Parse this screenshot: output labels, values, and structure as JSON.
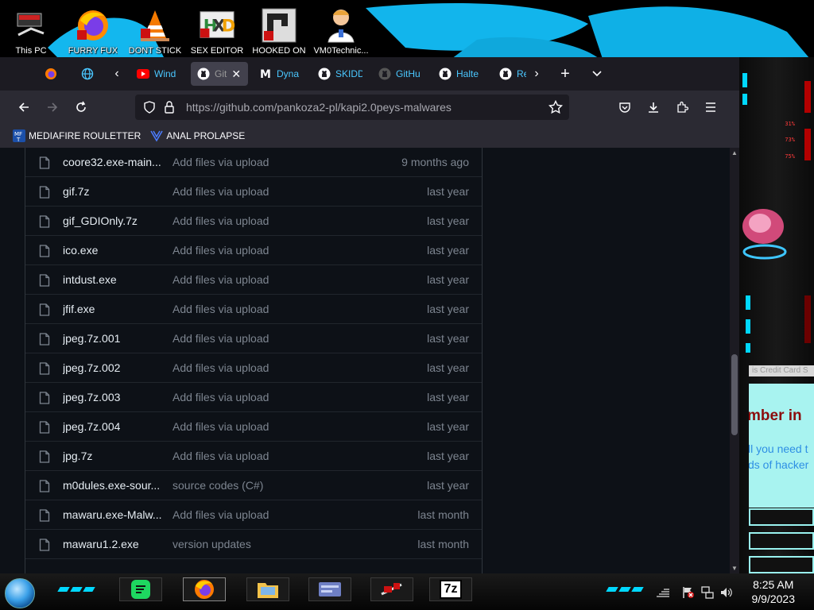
{
  "desktop": {
    "icons": [
      {
        "label": "This PC",
        "icon": "this-pc-icon"
      },
      {
        "label": "FURRY FUX",
        "icon": "firefox-icon"
      },
      {
        "label": "DONT STICK",
        "icon": "vlc-icon"
      },
      {
        "label": "SEX EDITOR",
        "icon": "hxd-icon"
      },
      {
        "label": "HOOKED ON",
        "icon": "hooked-on-icon"
      },
      {
        "label": "VM0Technic...",
        "icon": "doctor-icon"
      }
    ]
  },
  "side_panel": {
    "stats": [
      "31%",
      "73%",
      "75%"
    ],
    "cc_bar": "is Credit Card S",
    "cyan_big": "mber in",
    "cyan_line1": "ll you need t",
    "cyan_line2": "ds of hacker"
  },
  "tabs": [
    {
      "label": "",
      "icon": "firefox-icon"
    },
    {
      "label": "",
      "icon": "globe-icon"
    },
    {
      "label": "Wind",
      "icon": "youtube-icon"
    },
    {
      "label": "Git",
      "icon": "github-icon",
      "active": true
    },
    {
      "label": "Dyna",
      "icon": "mega-icon"
    },
    {
      "label": "SKIDD",
      "icon": "github-icon"
    },
    {
      "label": "GitHu",
      "icon": "github-icon"
    },
    {
      "label": "Halte",
      "icon": "github-icon"
    },
    {
      "label": "Re",
      "icon": "github-icon"
    }
  ],
  "url": {
    "prefix": "https://github.com",
    "path": "/pankoza2-pl/kapi2.0peys-malwares"
  },
  "bookmarks": [
    {
      "label": "MEDIAFIRE ROULETTER",
      "icon": "mediafire-icon"
    },
    {
      "label": "ANAL PROLAPSE",
      "icon": "bookmark-icon"
    }
  ],
  "files": [
    {
      "name": "coore32.exe-main...",
      "message": "Add files via upload",
      "date": "9 months ago"
    },
    {
      "name": "gif.7z",
      "message": "Add files via upload",
      "date": "last year"
    },
    {
      "name": "gif_GDIOnly.7z",
      "message": "Add files via upload",
      "date": "last year"
    },
    {
      "name": "ico.exe",
      "message": "Add files via upload",
      "date": "last year"
    },
    {
      "name": "intdust.exe",
      "message": "Add files via upload",
      "date": "last year"
    },
    {
      "name": "jfif.exe",
      "message": "Add files via upload",
      "date": "last year"
    },
    {
      "name": "jpeg.7z.001",
      "message": "Add files via upload",
      "date": "last year"
    },
    {
      "name": "jpeg.7z.002",
      "message": "Add files via upload",
      "date": "last year"
    },
    {
      "name": "jpeg.7z.003",
      "message": "Add files via upload",
      "date": "last year"
    },
    {
      "name": "jpeg.7z.004",
      "message": "Add files via upload",
      "date": "last year"
    },
    {
      "name": "jpg.7z",
      "message": "Add files via upload",
      "date": "last year"
    },
    {
      "name": "m0dules.exe-sour...",
      "message": "source codes (C#)",
      "date": "last year"
    },
    {
      "name": "mawaru.exe-Malw...",
      "message": "Add files via upload",
      "date": "last month"
    },
    {
      "name": "mawaru1.2.exe",
      "message": "version updates",
      "date": "last month"
    }
  ],
  "taskbar": {
    "time": "8:25 AM",
    "date": "9/9/2023",
    "apps": [
      "spotify-icon",
      "firefox-icon",
      "file-explorer-icon",
      "network-card-icon",
      "red-app-icon",
      "7zip-icon"
    ],
    "app_7z_label": "7z"
  }
}
